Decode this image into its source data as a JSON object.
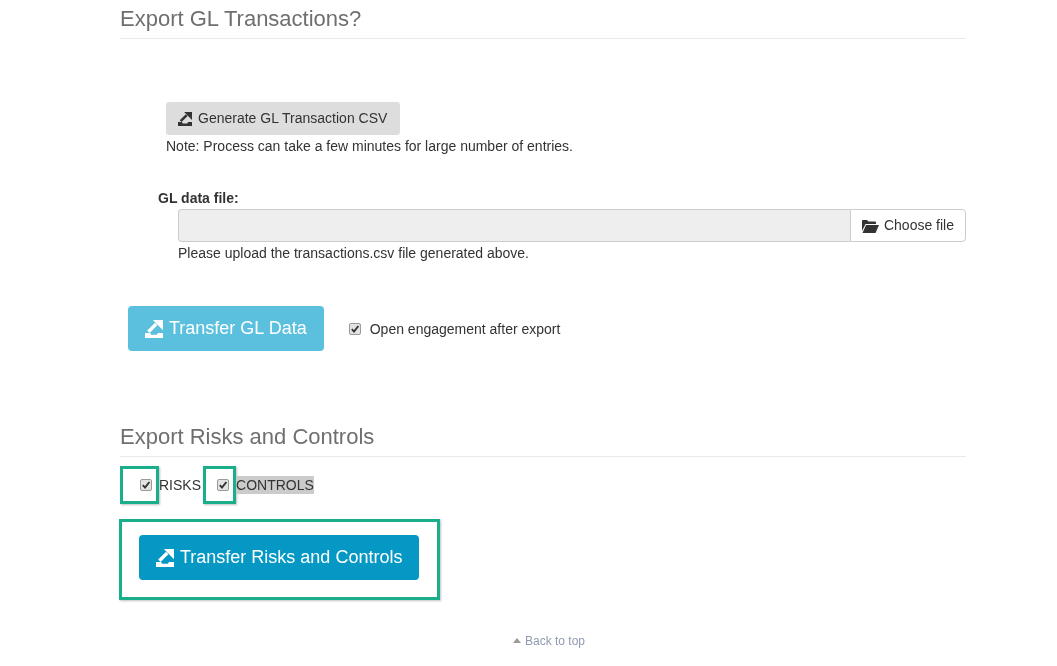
{
  "gl_export": {
    "heading": "Export GL Transactions?",
    "generate_button": {
      "label": "Generate GL Transaction CSV"
    },
    "note": "Note: Process can take a few minutes for large number of entries.",
    "file_field": {
      "label": "GL data file:",
      "button": "Choose file",
      "help": "Please upload the transactions.csv file generated above."
    },
    "transfer_button": {
      "label": "Transfer GL Data"
    },
    "open_after_export": {
      "label": "Open engagement after export",
      "checked": true
    }
  },
  "risks_controls": {
    "heading": "Export Risks and Controls",
    "options": [
      {
        "label": "RISKS",
        "checked": true,
        "callout": true,
        "text_selected": false
      },
      {
        "label": "CONTROLS",
        "checked": true,
        "callout": true,
        "text_selected": true
      }
    ],
    "transfer_button": {
      "label": "Transfer Risks and Controls",
      "callout": true
    }
  },
  "back_to_top": "Back to top"
}
